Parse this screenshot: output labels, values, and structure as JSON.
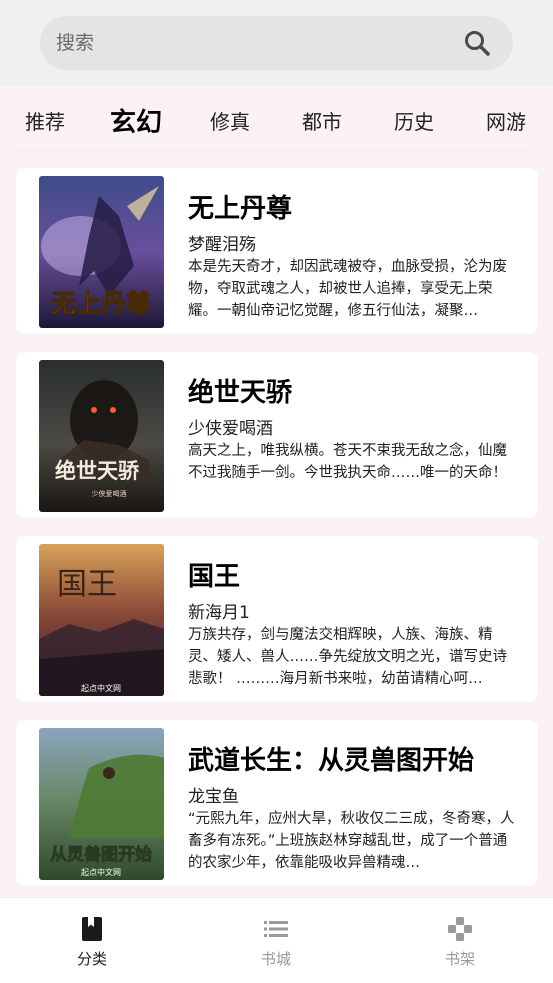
{
  "search": {
    "placeholder": "搜索"
  },
  "tabs": [
    {
      "label": "推荐"
    },
    {
      "label": "玄幻",
      "active": true
    },
    {
      "label": "修真"
    },
    {
      "label": "都市"
    },
    {
      "label": "历史"
    },
    {
      "label": "网游"
    }
  ],
  "books": [
    {
      "title": "无上丹尊",
      "author": "梦醒泪殇",
      "description": "本是先天奇才，却因武魂被夺，血脉受损，沦为废物，夺取武魂之人，却被世人追捧，享受无上荣耀。一朝仙帝记忆觉醒，修五行仙法，凝聚…",
      "cover_text": "无上丹尊"
    },
    {
      "title": "绝世天骄",
      "author": "少侠爱喝酒",
      "description": "高天之上，唯我纵横。苍天不束我无敌之念，仙魔不过我随手一剑。今世我执天命……唯一的天命！",
      "cover_text": "绝世天骄",
      "cover_subtext": "少侠爱喝酒"
    },
    {
      "title": "国王",
      "author": "新海月1",
      "description": "万族共存，剑与魔法交相辉映，人族、海族、精灵、矮人、兽人……争先绽放文明之光，谱写史诗悲歌！ ………海月新书来啦，幼苗请精心呵…",
      "cover_text": "国王",
      "cover_subtext": "起点中文网"
    },
    {
      "title": "武道长生：从灵兽图开始",
      "author": "龙宝鱼",
      "description": "“元熙九年，应州大旱，秋收仅二三成，冬奇寒，人畜多有冻死。”上班族赵林穿越乱世，成了一个普通的农家少年，依靠能吸收异兽精魂…",
      "cover_text": "从灵兽图开始",
      "cover_subtext": "起点中文网"
    }
  ],
  "bottom_nav": [
    {
      "label": "分类",
      "icon": "book-icon",
      "active": true
    },
    {
      "label": "书城",
      "icon": "list-icon"
    },
    {
      "label": "书架",
      "icon": "gamepad-icon"
    }
  ],
  "colors": {
    "background": "#fdf2f3",
    "search_bar": "#e4e4e4",
    "card": "#ffffff",
    "nav_inactive": "#999999"
  }
}
